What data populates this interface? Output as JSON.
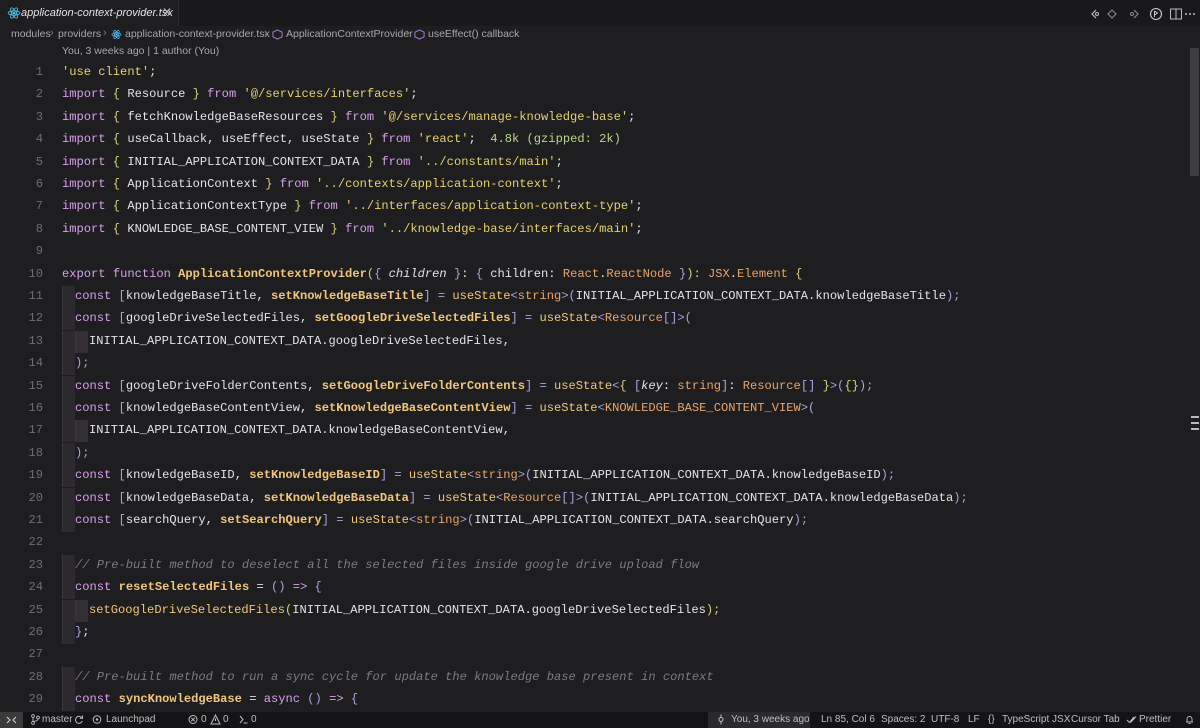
{
  "tab": {
    "label": "application-context-provider.tsx",
    "close": "✕"
  },
  "breadcrumbs": {
    "items": [
      "modules",
      "providers",
      "application-context-provider.tsx",
      "ApplicationContextProvider",
      "useEffect() callback"
    ]
  },
  "codelens": "You, 3 weeks ago | 1 author (You)",
  "line_numbers": [
    "1",
    "2",
    "3",
    "4",
    "5",
    "6",
    "7",
    "8",
    "9",
    "10",
    "11",
    "12",
    "13",
    "14",
    "15",
    "16",
    "17",
    "18",
    "19",
    "20",
    "21",
    "22",
    "23",
    "24",
    "25",
    "26",
    "27",
    "28",
    "29"
  ],
  "code": {
    "l1": [
      "'use client'",
      ";"
    ],
    "l2": [
      "import",
      " { ",
      "Resource",
      " } ",
      "from",
      " ",
      "'@/services/interfaces'",
      ";"
    ],
    "l3": [
      "import",
      " { ",
      "fetchKnowledgeBaseResources",
      " } ",
      "from",
      " ",
      "'@/services/manage-knowledge-base'",
      ";"
    ],
    "l4": [
      "import",
      " { ",
      "useCallback, useEffect, useState",
      " } ",
      "from",
      " ",
      "'react'",
      ";",
      "  4.8k (gzipped: 2k)"
    ],
    "l5": [
      "import",
      " { ",
      "INITIAL_APPLICATION_CONTEXT_DATA",
      " } ",
      "from",
      " ",
      "'../constants/main'",
      ";"
    ],
    "l6": [
      "import",
      " { ",
      "ApplicationContext",
      " } ",
      "from",
      " ",
      "'../contexts/application-context'",
      ";"
    ],
    "l7": [
      "import",
      " { ",
      "ApplicationContextType",
      " } ",
      "from",
      " ",
      "'../interfaces/application-context-type'",
      ";"
    ],
    "l8": [
      "import",
      " { ",
      "KNOWLEDGE_BASE_CONTENT_VIEW",
      " } ",
      "from",
      " ",
      "'../knowledge-base/interfaces/main'",
      ";"
    ],
    "l10": [
      "export",
      " ",
      "function",
      " ",
      "ApplicationContextProvider",
      "(",
      "{ ",
      "children",
      " }",
      ": ",
      "{ ",
      "children",
      ": ",
      "React",
      ".",
      "ReactNode",
      " }",
      "): ",
      "JSX",
      ".",
      "Element",
      " {"
    ],
    "l11": [
      "const",
      " [",
      "knowledgeBaseTitle",
      ", ",
      "setKnowledgeBaseTitle",
      "] = ",
      "useState",
      "<",
      "string",
      ">(",
      "INITIAL_APPLICATION_CONTEXT_DATA",
      ".",
      "knowledgeBaseTitle",
      ");"
    ],
    "l12": [
      "const",
      " [",
      "googleDriveSelectedFiles",
      ", ",
      "setGoogleDriveSelectedFiles",
      "] = ",
      "useState",
      "<",
      "Resource",
      "[]",
      ">("
    ],
    "l13": [
      "INITIAL_APPLICATION_CONTEXT_DATA",
      ".",
      "googleDriveSelectedFiles",
      ","
    ],
    "l14": [
      ");"
    ],
    "l15": [
      "const",
      " [",
      "googleDriveFolderContents",
      ", ",
      "setGoogleDriveFolderContents",
      "] = ",
      "useState",
      "<",
      "{ ",
      "[",
      "key",
      ": ",
      "string",
      "]",
      ": ",
      "Resource",
      "[]",
      " }",
      ">(",
      "{}",
      ");"
    ],
    "l16": [
      "const",
      " [",
      "knowledgeBaseContentView",
      ", ",
      "setKnowledgeBaseContentView",
      "] = ",
      "useState",
      "<",
      "KNOWLEDGE_BASE_CONTENT_VIEW",
      ">("
    ],
    "l17": [
      "INITIAL_APPLICATION_CONTEXT_DATA",
      ".",
      "knowledgeBaseContentView",
      ","
    ],
    "l18": [
      ");"
    ],
    "l19": [
      "const",
      " [",
      "knowledgeBaseID",
      ", ",
      "setKnowledgeBaseID",
      "] = ",
      "useState",
      "<",
      "string",
      ">(",
      "INITIAL_APPLICATION_CONTEXT_DATA",
      ".",
      "knowledgeBaseID",
      ");"
    ],
    "l20": [
      "const",
      " [",
      "knowledgeBaseData",
      ", ",
      "setKnowledgeBaseData",
      "] = ",
      "useState",
      "<",
      "Resource",
      "[]",
      ">(",
      "INITIAL_APPLICATION_CONTEXT_DATA",
      ".",
      "knowledgeBaseData",
      ");"
    ],
    "l21": [
      "const",
      " [",
      "searchQuery",
      ", ",
      "setSearchQuery",
      "] = ",
      "useState",
      "<",
      "string",
      ">(",
      "INITIAL_APPLICATION_CONTEXT_DATA",
      ".",
      "searchQuery",
      ");"
    ],
    "l23": [
      "// Pre-built method to deselect all the selected files inside google drive upload flow"
    ],
    "l24": [
      "const",
      " ",
      "resetSelectedFiles",
      " = ",
      "()",
      " => ",
      "{"
    ],
    "l25": [
      "setGoogleDriveSelectedFiles",
      "(",
      "INITIAL_APPLICATION_CONTEXT_DATA",
      ".",
      "googleDriveSelectedFiles",
      ");"
    ],
    "l26": [
      "}",
      ";"
    ],
    "l28": [
      "// Pre-built method to run a sync cycle for update the knowledge base present in context"
    ],
    "l29": [
      "const",
      " ",
      "syncKnowledgeBase",
      " = ",
      "async",
      " ",
      "()",
      " => ",
      "{"
    ]
  },
  "statusbar": {
    "branch": "master",
    "launchpad": "Launchpad",
    "errors": "0",
    "warnings": "0",
    "ports": "0",
    "blame": "You, 3 weeks ago",
    "position": "Ln 85, Col 6",
    "spaces": "Spaces: 2",
    "encoding": "UTF-8",
    "eol": "LF",
    "language": "TypeScript JSX",
    "cursor_tab": "Cursor Tab",
    "prettier": "Prettier"
  },
  "icons": {
    "tab": "react-icon",
    "actions": [
      "go-back-icon",
      "go-forward-icon",
      "go-forward-alt-icon",
      "split-editor-icon",
      "more-actions-icon"
    ]
  }
}
